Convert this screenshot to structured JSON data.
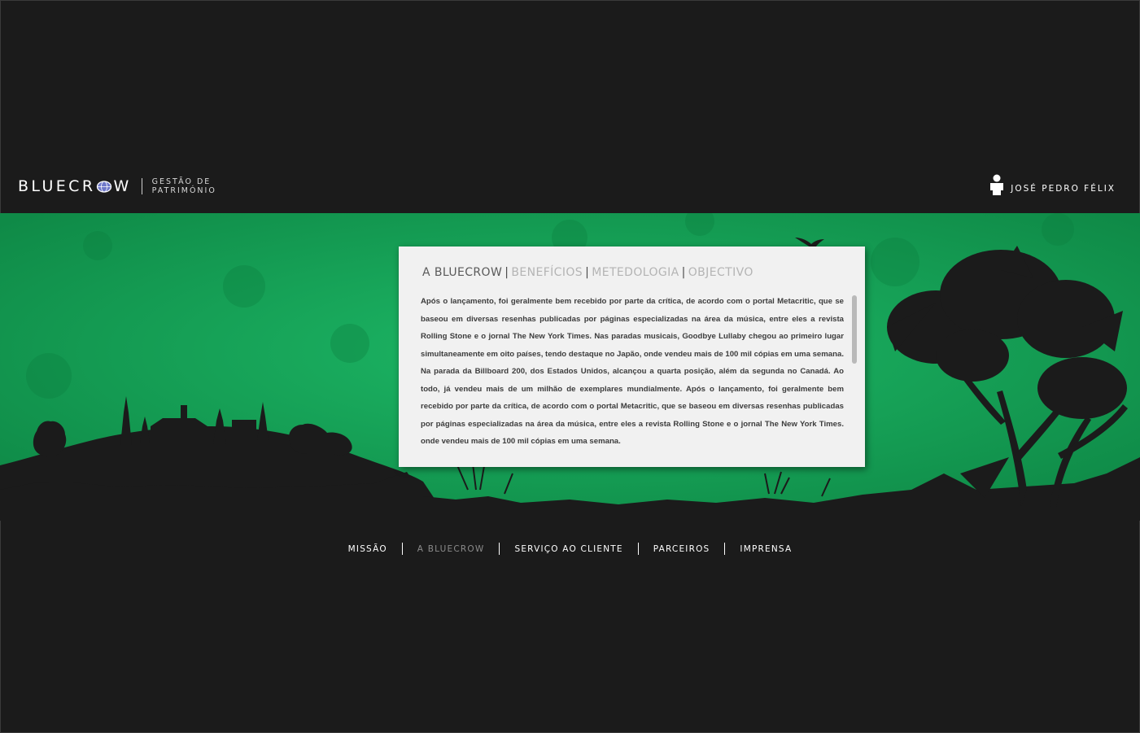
{
  "header": {
    "brand": "BLUECROW",
    "tagline_line1": "GESTÃO DE",
    "tagline_line2": "PATRIMÓNIO",
    "user_name": "JOSÉ PEDRO FÉLIX",
    "user_icon": "user-icon"
  },
  "card": {
    "tabs": [
      {
        "label": "A BLUECROW",
        "active": true
      },
      {
        "label": "BENEFÍCIOS",
        "active": false
      },
      {
        "label": "METEDOLOGIA",
        "active": false
      },
      {
        "label": "OBJECTIVO",
        "active": false
      }
    ],
    "separator": "|",
    "body": "Após o lançamento, foi geralmente bem recebido por parte da crítica, de acordo com o portal Metacritic, que se baseou em diversas resenhas publicadas por páginas especializadas na área da música, entre eles a revista Rolling Stone e o jornal The New York Times. Nas paradas musicais, Goodbye Lullaby chegou ao primeiro lugar simultaneamente em oito países, tendo destaque no Japão, onde vendeu mais de 100 mil cópias em uma semana. Na parada da Billboard 200, dos Estados Unidos, alcançou a quarta posição, além da segunda no Canadá. Ao todo, já vendeu mais de um milhão de exemplares mundialmente. Após o lançamento, foi geralmente bem recebido por parte da crítica, de acordo com o portal Metacritic, que se baseou em diversas resenhas publicadas por páginas especializadas na área da música, entre eles a revista Rolling Stone e o jornal The New York Times. onde vendeu mais de 100 mil cópias em uma semana."
  },
  "nav": {
    "items": [
      {
        "label": "MISSÃO",
        "active": false
      },
      {
        "label": "A BLUECROW",
        "active": true
      },
      {
        "label": "SERVIÇO AO CLIENTE",
        "active": false
      },
      {
        "label": "PARCEIROS",
        "active": false
      },
      {
        "label": "IMPRENSA",
        "active": false
      }
    ]
  },
  "colors": {
    "background": "#1b1b1b",
    "green": "#16a659",
    "card": "#f1f1f1",
    "tab_active": "#5a5a5a",
    "tab_inactive": "#b4b4b4",
    "nav_active": "#8b8b8b"
  }
}
